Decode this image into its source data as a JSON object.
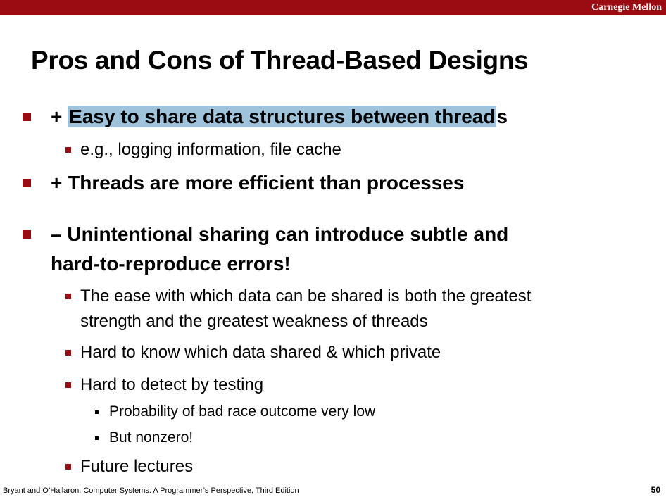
{
  "header": {
    "brand": "Carnegie Mellon"
  },
  "slide": {
    "title": "Pros and Cons of Thread-Based Designs",
    "bullets": [
      {
        "prefix": "+ ",
        "highlight": "Easy to share data structures between thread",
        "suffix": "s"
      },
      {
        "text": "e.g., logging information, file cache"
      },
      {
        "text": "+ Threads are more efficient than processes"
      },
      {
        "line1": "– Unintentional sharing can introduce subtle and",
        "line2": "hard-to-reproduce errors!"
      },
      {
        "line1": "The ease with which data can be shared is both the greatest",
        "line2": "strength and the greatest weakness of threads"
      },
      {
        "text": "Hard to know which data shared & which private"
      },
      {
        "text": "Hard to detect by testing"
      },
      {
        "text": "Probability of bad race outcome very low"
      },
      {
        "text": "But nonzero!"
      },
      {
        "text": "Future lectures"
      }
    ]
  },
  "footer": {
    "citation": "Bryant and O’Hallaron, Computer Systems: A Programmer’s Perspective, Third Edition",
    "page": "50"
  },
  "colors": {
    "header_bar": "#9b0b12",
    "highlight": "#9ec3db",
    "bullet_marker": "#9b0b12"
  }
}
